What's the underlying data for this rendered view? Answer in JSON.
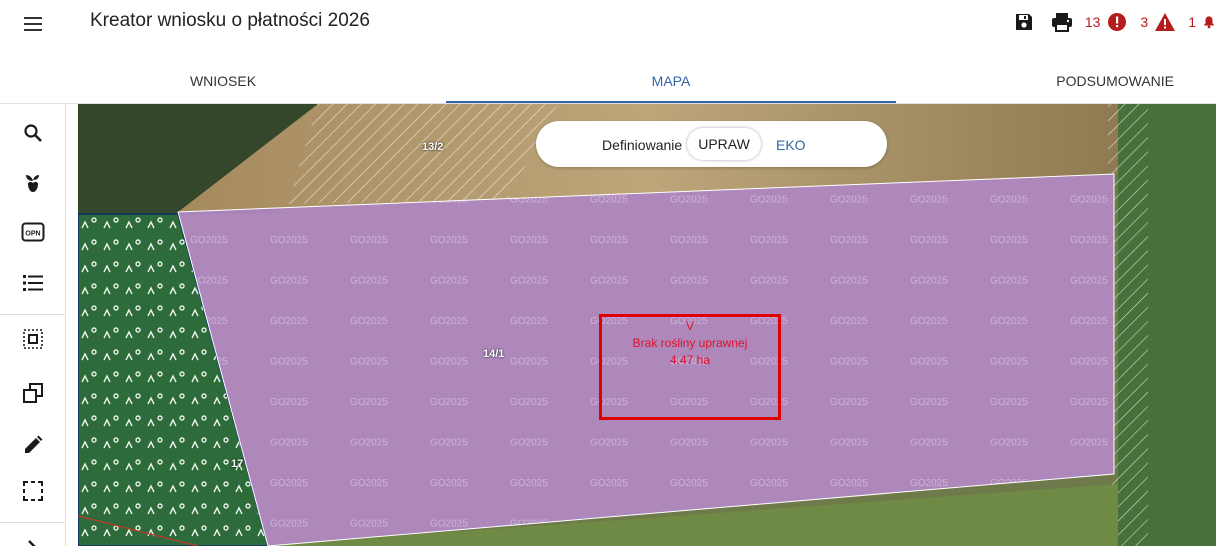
{
  "header": {
    "title": "Kreator wniosku o płatności 2026",
    "errors_count": "13",
    "warnings_count": "3",
    "notifications_count": "1",
    "icons": [
      "menu-icon",
      "save-icon",
      "print-icon",
      "error-icon",
      "warning-icon",
      "bell-icon"
    ]
  },
  "tabs": [
    {
      "label": "WNIOSEK",
      "active": false
    },
    {
      "label": "MAPA",
      "active": true
    },
    {
      "label": "PODSUMOWANIE",
      "active": false
    }
  ],
  "toolbar": {
    "tools": [
      "search-icon",
      "plant-icon",
      "opn-icon",
      "list-icon",
      "select-area-icon",
      "copy-icon",
      "edit-pencil-icon",
      "draw-rectangle-icon",
      "next-arrow-icon"
    ],
    "opn_label": "OPN"
  },
  "mode_toggle": {
    "label": "Definiowanie",
    "option_upraw": "UPRAW",
    "option_eko": "EKO",
    "selected": "UPRAW"
  },
  "map": {
    "parcel_labels": [
      "13/2",
      "14/1",
      "17"
    ],
    "watermark": "GO2025",
    "selected_parcel": {
      "code": "V",
      "status": "Brak rośliny uprawnej",
      "area": "4.47 ha"
    },
    "colors": {
      "parcel_fill": "#b389c4",
      "parcel_border": "#ffffff",
      "selection_border": "#e00000",
      "selection_text": "#e0102a"
    }
  },
  "colors": {
    "accent": "#3564a8",
    "alert": "#b71c1c"
  }
}
